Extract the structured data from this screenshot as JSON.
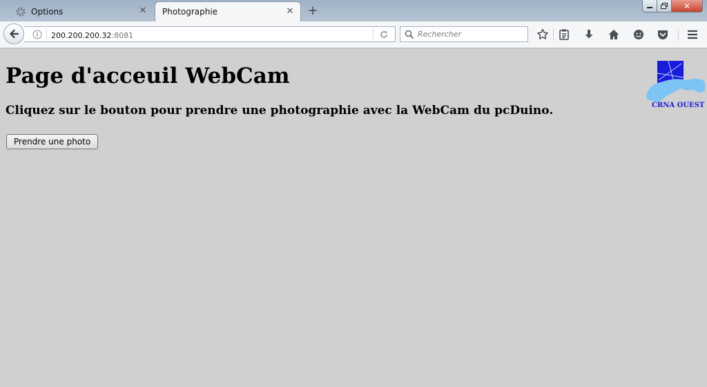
{
  "tabs": [
    {
      "label": "Options",
      "icon": "gear-icon",
      "active": false
    },
    {
      "label": "Photographie",
      "active": true
    }
  ],
  "url": {
    "host": "200.200.200.32",
    "port": ":8081"
  },
  "search": {
    "placeholder": "Rechercher"
  },
  "page": {
    "title": "Page d'acceuil WebCam",
    "instructions": "Cliquez sur le bouton pour prendre une photographie avec la WebCam du pcDuino.",
    "button_label": "Prendre une photo",
    "logo_text": "CRNA OUEST"
  },
  "colors": {
    "page_background": "#d0d0d0",
    "logo_blue": "#1a1adc",
    "logo_light_blue": "#7cc4f4"
  }
}
